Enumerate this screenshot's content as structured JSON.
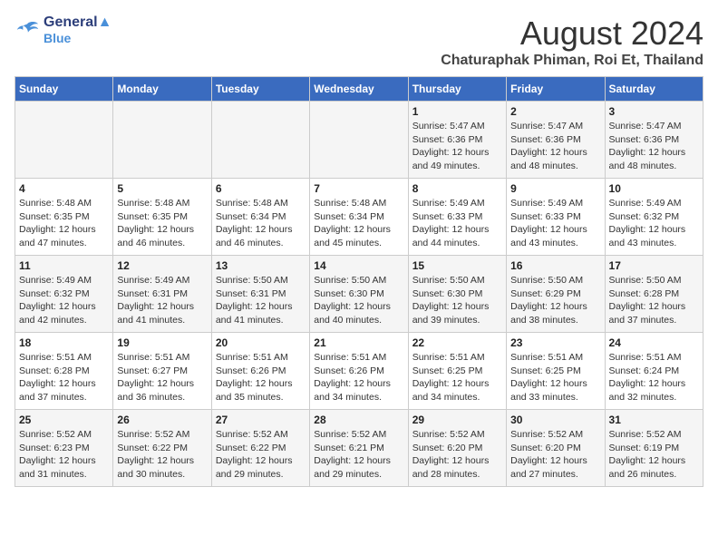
{
  "header": {
    "logo_line1": "General",
    "logo_line2": "Blue",
    "month_year": "August 2024",
    "location": "Chaturaphak Phiman, Roi Et, Thailand"
  },
  "weekdays": [
    "Sunday",
    "Monday",
    "Tuesday",
    "Wednesday",
    "Thursday",
    "Friday",
    "Saturday"
  ],
  "weeks": [
    [
      {
        "day": "",
        "info": ""
      },
      {
        "day": "",
        "info": ""
      },
      {
        "day": "",
        "info": ""
      },
      {
        "day": "",
        "info": ""
      },
      {
        "day": "1",
        "info": "Sunrise: 5:47 AM\nSunset: 6:36 PM\nDaylight: 12 hours\nand 49 minutes."
      },
      {
        "day": "2",
        "info": "Sunrise: 5:47 AM\nSunset: 6:36 PM\nDaylight: 12 hours\nand 48 minutes."
      },
      {
        "day": "3",
        "info": "Sunrise: 5:47 AM\nSunset: 6:36 PM\nDaylight: 12 hours\nand 48 minutes."
      }
    ],
    [
      {
        "day": "4",
        "info": "Sunrise: 5:48 AM\nSunset: 6:35 PM\nDaylight: 12 hours\nand 47 minutes."
      },
      {
        "day": "5",
        "info": "Sunrise: 5:48 AM\nSunset: 6:35 PM\nDaylight: 12 hours\nand 46 minutes."
      },
      {
        "day": "6",
        "info": "Sunrise: 5:48 AM\nSunset: 6:34 PM\nDaylight: 12 hours\nand 46 minutes."
      },
      {
        "day": "7",
        "info": "Sunrise: 5:48 AM\nSunset: 6:34 PM\nDaylight: 12 hours\nand 45 minutes."
      },
      {
        "day": "8",
        "info": "Sunrise: 5:49 AM\nSunset: 6:33 PM\nDaylight: 12 hours\nand 44 minutes."
      },
      {
        "day": "9",
        "info": "Sunrise: 5:49 AM\nSunset: 6:33 PM\nDaylight: 12 hours\nand 43 minutes."
      },
      {
        "day": "10",
        "info": "Sunrise: 5:49 AM\nSunset: 6:32 PM\nDaylight: 12 hours\nand 43 minutes."
      }
    ],
    [
      {
        "day": "11",
        "info": "Sunrise: 5:49 AM\nSunset: 6:32 PM\nDaylight: 12 hours\nand 42 minutes."
      },
      {
        "day": "12",
        "info": "Sunrise: 5:49 AM\nSunset: 6:31 PM\nDaylight: 12 hours\nand 41 minutes."
      },
      {
        "day": "13",
        "info": "Sunrise: 5:50 AM\nSunset: 6:31 PM\nDaylight: 12 hours\nand 41 minutes."
      },
      {
        "day": "14",
        "info": "Sunrise: 5:50 AM\nSunset: 6:30 PM\nDaylight: 12 hours\nand 40 minutes."
      },
      {
        "day": "15",
        "info": "Sunrise: 5:50 AM\nSunset: 6:30 PM\nDaylight: 12 hours\nand 39 minutes."
      },
      {
        "day": "16",
        "info": "Sunrise: 5:50 AM\nSunset: 6:29 PM\nDaylight: 12 hours\nand 38 minutes."
      },
      {
        "day": "17",
        "info": "Sunrise: 5:50 AM\nSunset: 6:28 PM\nDaylight: 12 hours\nand 37 minutes."
      }
    ],
    [
      {
        "day": "18",
        "info": "Sunrise: 5:51 AM\nSunset: 6:28 PM\nDaylight: 12 hours\nand 37 minutes."
      },
      {
        "day": "19",
        "info": "Sunrise: 5:51 AM\nSunset: 6:27 PM\nDaylight: 12 hours\nand 36 minutes."
      },
      {
        "day": "20",
        "info": "Sunrise: 5:51 AM\nSunset: 6:26 PM\nDaylight: 12 hours\nand 35 minutes."
      },
      {
        "day": "21",
        "info": "Sunrise: 5:51 AM\nSunset: 6:26 PM\nDaylight: 12 hours\nand 34 minutes."
      },
      {
        "day": "22",
        "info": "Sunrise: 5:51 AM\nSunset: 6:25 PM\nDaylight: 12 hours\nand 34 minutes."
      },
      {
        "day": "23",
        "info": "Sunrise: 5:51 AM\nSunset: 6:25 PM\nDaylight: 12 hours\nand 33 minutes."
      },
      {
        "day": "24",
        "info": "Sunrise: 5:51 AM\nSunset: 6:24 PM\nDaylight: 12 hours\nand 32 minutes."
      }
    ],
    [
      {
        "day": "25",
        "info": "Sunrise: 5:52 AM\nSunset: 6:23 PM\nDaylight: 12 hours\nand 31 minutes."
      },
      {
        "day": "26",
        "info": "Sunrise: 5:52 AM\nSunset: 6:22 PM\nDaylight: 12 hours\nand 30 minutes."
      },
      {
        "day": "27",
        "info": "Sunrise: 5:52 AM\nSunset: 6:22 PM\nDaylight: 12 hours\nand 29 minutes."
      },
      {
        "day": "28",
        "info": "Sunrise: 5:52 AM\nSunset: 6:21 PM\nDaylight: 12 hours\nand 29 minutes."
      },
      {
        "day": "29",
        "info": "Sunrise: 5:52 AM\nSunset: 6:20 PM\nDaylight: 12 hours\nand 28 minutes."
      },
      {
        "day": "30",
        "info": "Sunrise: 5:52 AM\nSunset: 6:20 PM\nDaylight: 12 hours\nand 27 minutes."
      },
      {
        "day": "31",
        "info": "Sunrise: 5:52 AM\nSunset: 6:19 PM\nDaylight: 12 hours\nand 26 minutes."
      }
    ]
  ]
}
